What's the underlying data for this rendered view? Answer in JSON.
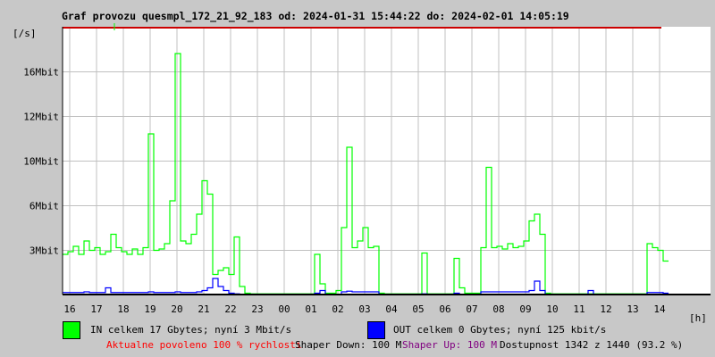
{
  "chart_data": {
    "type": "line",
    "title": "Graf provozu quesmpl_172_21_92_183 od: 2024-01-31 15:44:22 do: 2024-02-01 14:05:19",
    "ylabel": "[/s]",
    "xlabel": "[h]",
    "y_ticks": [
      {
        "label": "3Mbit",
        "value": 3.333
      },
      {
        "label": "6Mbit",
        "value": 6.667
      },
      {
        "label": "10Mbit",
        "value": 10
      },
      {
        "label": "12Mbit",
        "value": 13.333
      },
      {
        "label": "16Mbit",
        "value": 16.667
      }
    ],
    "ylim": [
      0,
      20
    ],
    "x_ticks": [
      "16",
      "17",
      "18",
      "19",
      "20",
      "21",
      "22",
      "23",
      "00",
      "01",
      "02",
      "03",
      "04",
      "05",
      "06",
      "07",
      "08",
      "09",
      "10",
      "11",
      "12",
      "13",
      "14"
    ],
    "x_start": "15:44",
    "x_step_minutes": 12,
    "grid": true,
    "series": [
      {
        "name": "IN",
        "color": "#00ff00",
        "unit": "Mbit/s",
        "values": [
          3.0,
          3.2,
          3.6,
          3.0,
          4.0,
          3.3,
          3.5,
          3.0,
          3.2,
          4.5,
          3.5,
          3.2,
          3.0,
          3.4,
          3.0,
          3.5,
          12,
          3.3,
          3.4,
          3.8,
          7.0,
          18,
          4.0,
          3.8,
          4.5,
          6.0,
          8.5,
          7.5,
          1.5,
          1.8,
          2.0,
          1.5,
          4.3,
          0.6,
          0.1,
          0.05,
          0.05,
          0.05,
          0.05,
          0.05,
          0.05,
          0.05,
          0.05,
          0.05,
          0.05,
          0.05,
          0.05,
          3.0,
          0.8,
          0.1,
          0.1,
          0.3,
          5.0,
          11,
          3.5,
          4.0,
          5.0,
          3.5,
          3.6,
          0.1,
          0.05,
          0.05,
          0.05,
          0.05,
          0.05,
          0.05,
          0.05,
          3.1,
          0.05,
          0.05,
          0.05,
          0.05,
          0.05,
          2.7,
          0.5,
          0.1,
          0.1,
          0.1,
          3.5,
          9.5,
          3.5,
          3.6,
          3.4,
          3.8,
          3.5,
          3.6,
          4.0,
          5.5,
          6.0,
          4.5,
          0.1,
          0.05,
          0.05,
          0.05,
          0.05,
          0.05,
          0.05,
          0.05,
          0.05,
          0.05,
          0.05,
          0.05,
          0.05,
          0.05,
          0.05,
          0.05,
          0.05,
          0.05,
          0.05,
          3.8,
          3.5,
          3.3,
          2.5
        ]
      },
      {
        "name": "OUT",
        "color": "#0000ff",
        "unit": "Mbit/s",
        "values": [
          0.15,
          0.15,
          0.15,
          0.15,
          0.2,
          0.15,
          0.15,
          0.15,
          0.5,
          0.15,
          0.15,
          0.15,
          0.15,
          0.15,
          0.15,
          0.15,
          0.2,
          0.15,
          0.15,
          0.15,
          0.15,
          0.2,
          0.15,
          0.15,
          0.15,
          0.2,
          0.3,
          0.5,
          1.2,
          0.6,
          0.3,
          0.1,
          0.05,
          0.02,
          0.02,
          0.02,
          0.02,
          0.02,
          0.02,
          0.02,
          0.02,
          0.02,
          0.02,
          0.02,
          0.02,
          0.02,
          0.02,
          0.1,
          0.3,
          0.02,
          0.02,
          0.02,
          0.2,
          0.25,
          0.2,
          0.2,
          0.2,
          0.2,
          0.2,
          0.02,
          0.02,
          0.02,
          0.02,
          0.02,
          0.02,
          0.02,
          0.02,
          0.05,
          0.02,
          0.02,
          0.02,
          0.02,
          0.02,
          0.1,
          0.02,
          0.02,
          0.02,
          0.02,
          0.2,
          0.2,
          0.2,
          0.2,
          0.2,
          0.2,
          0.2,
          0.2,
          0.2,
          0.3,
          1.0,
          0.3,
          0.02,
          0.02,
          0.02,
          0.02,
          0.02,
          0.02,
          0.02,
          0.02,
          0.3,
          0.02,
          0.02,
          0.02,
          0.02,
          0.02,
          0.02,
          0.02,
          0.02,
          0.02,
          0.02,
          0.15,
          0.15,
          0.15,
          0.1
        ]
      }
    ]
  },
  "legend": {
    "in_text": "IN celkem 17 Gbytes; nyní 3 Mbit/s",
    "out_text": "OUT celkem 0 Gbytes; nyní 125 kbit/s"
  },
  "status": {
    "allowed": "Aktualne povoleno 100 % rychlosti",
    "shaper_down": "Shaper Down: 100 M",
    "shaper_up": "Shaper Up: 100 M",
    "availability": "Dostupnost 1342 z 1440 (93.2 %)"
  },
  "colors": {
    "allowed": "#ff0000",
    "shaper_up": "#800080",
    "limit_line": "#cc0000"
  }
}
